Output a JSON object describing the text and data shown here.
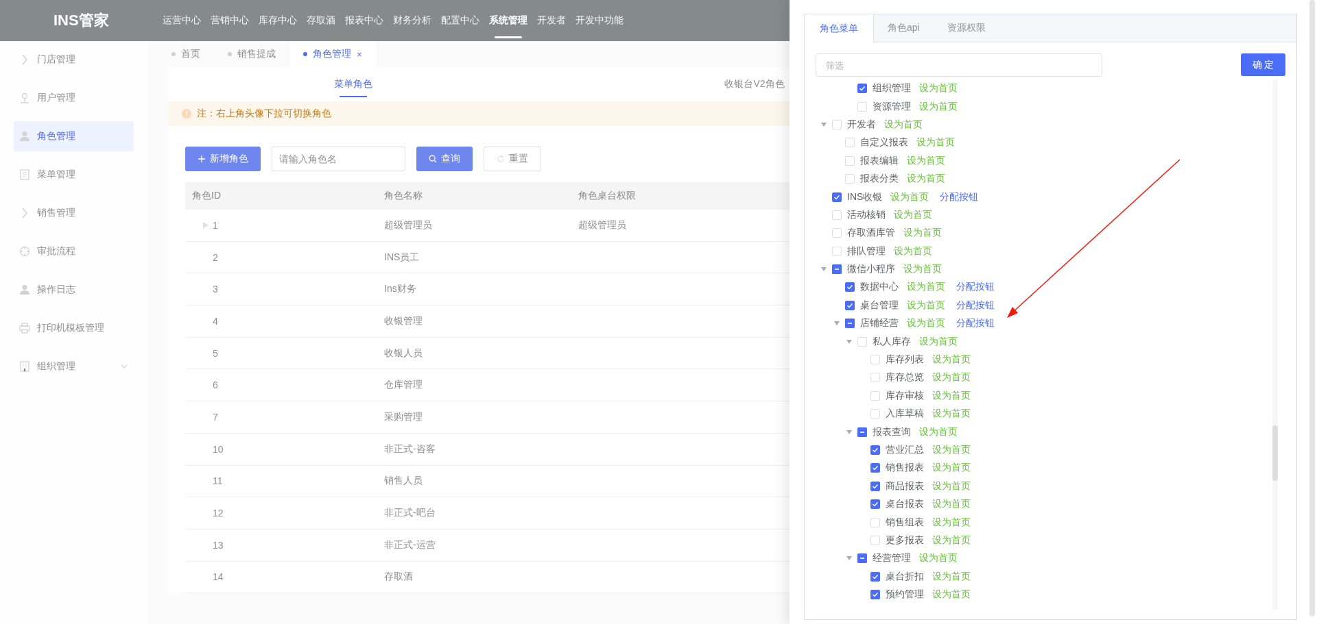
{
  "app": {
    "logo": "INS管家"
  },
  "top_nav": [
    {
      "label": "运营中心",
      "selected": false
    },
    {
      "label": "营销中心",
      "selected": false
    },
    {
      "label": "库存中心",
      "selected": false
    },
    {
      "label": "存取酒",
      "selected": false
    },
    {
      "label": "报表中心",
      "selected": false
    },
    {
      "label": "财务分析",
      "selected": false
    },
    {
      "label": "配置中心",
      "selected": false
    },
    {
      "label": "系统管理",
      "selected": true
    },
    {
      "label": "开发者",
      "selected": false
    },
    {
      "label": "开发中功能",
      "selected": false
    }
  ],
  "sidebar": {
    "items": [
      {
        "label": "门店管理",
        "selected": false
      },
      {
        "label": "用户管理",
        "selected": false
      },
      {
        "label": "角色管理",
        "selected": true
      },
      {
        "label": "菜单管理",
        "selected": false
      },
      {
        "label": "销售管理",
        "selected": false
      },
      {
        "label": "审批流程",
        "selected": false
      },
      {
        "label": "操作日志",
        "selected": false
      },
      {
        "label": "打印机模板管理",
        "selected": false
      },
      {
        "label": "组织管理",
        "selected": false,
        "expandable": true
      }
    ]
  },
  "page_tabs": [
    {
      "label": "首页",
      "selected": false,
      "closable": false
    },
    {
      "label": "销售提成",
      "selected": false,
      "closable": false
    },
    {
      "label": "角色管理",
      "selected": true,
      "closable": true,
      "close": "×"
    }
  ],
  "role_tabs": [
    {
      "label": "菜单角色",
      "selected": true
    },
    {
      "label": "收银台V2角色",
      "selected": false
    }
  ],
  "notice": "注：右上角头像下拉可切换角色",
  "toolbar": {
    "add_button": "新增角色",
    "search": {
      "placeholder": "请输入角色名"
    },
    "query_button": "查询",
    "reset_button": "重置"
  },
  "table": {
    "columns": [
      "角色ID",
      "角色名称",
      "角色桌台权限"
    ],
    "rows": [
      {
        "cells": [
          "1",
          "超级管理员",
          "超级管理员"
        ],
        "expandable": true
      },
      {
        "cells": [
          "2",
          "INS员工",
          ""
        ],
        "expandable": false
      },
      {
        "cells": [
          "3",
          "Ins财务",
          ""
        ],
        "expandable": false
      },
      {
        "cells": [
          "4",
          "收银管理",
          ""
        ],
        "expandable": false
      },
      {
        "cells": [
          "5",
          "收银人员",
          ""
        ],
        "expandable": false
      },
      {
        "cells": [
          "6",
          "仓库管理",
          ""
        ],
        "expandable": false
      },
      {
        "cells": [
          "7",
          "采购管理",
          ""
        ],
        "expandable": false
      },
      {
        "cells": [
          "10",
          "非正式-咨客",
          ""
        ],
        "expandable": false
      },
      {
        "cells": [
          "11",
          "销售人员",
          ""
        ],
        "expandable": false
      },
      {
        "cells": [
          "12",
          "非正式-吧台",
          ""
        ],
        "expandable": false
      },
      {
        "cells": [
          "13",
          "非正式-运营",
          ""
        ],
        "expandable": false
      },
      {
        "cells": [
          "14",
          "存取酒",
          ""
        ],
        "expandable": false
      }
    ]
  },
  "drawer": {
    "tabs": [
      {
        "label": "角色菜单",
        "selected": true
      },
      {
        "label": "角色api",
        "selected": false
      },
      {
        "label": "资源权限",
        "selected": false
      }
    ],
    "filter": {
      "placeholder": "筛选"
    },
    "confirm_button": "确 定",
    "tree": [
      {
        "children": [
          {
            "children": [
              {
                "label": "组织管理",
                "checked": true,
                "indeterminate": false,
                "actions": [
                  {
                    "kind": "home",
                    "label": "设为首页"
                  }
                ]
              },
              {
                "label": "资源管理",
                "checked": false,
                "indeterminate": false,
                "actions": [
                  {
                    "kind": "home",
                    "label": "设为首页"
                  }
                ]
              }
            ]
          }
        ]
      },
      {
        "label": "开发者",
        "checked": false,
        "indeterminate": false,
        "expanded": true,
        "actions": [
          {
            "kind": "home",
            "label": "设为首页"
          }
        ],
        "children": [
          {
            "label": "自定义报表",
            "checked": false,
            "indeterminate": false,
            "actions": [
              {
                "kind": "home",
                "label": "设为首页"
              }
            ]
          },
          {
            "label": "报表编辑",
            "checked": false,
            "indeterminate": false,
            "actions": [
              {
                "kind": "home",
                "label": "设为首页"
              }
            ]
          },
          {
            "label": "报表分类",
            "checked": false,
            "indeterminate": false,
            "actions": [
              {
                "kind": "home",
                "label": "设为首页"
              }
            ]
          }
        ]
      },
      {
        "label": "INS收银",
        "checked": true,
        "indeterminate": false,
        "actions": [
          {
            "kind": "home",
            "label": "设为首页"
          },
          {
            "kind": "assign",
            "label": "分配按钮"
          }
        ]
      },
      {
        "label": "活动核销",
        "checked": false,
        "indeterminate": false,
        "actions": [
          {
            "kind": "home",
            "label": "设为首页"
          }
        ]
      },
      {
        "label": "存取酒库管",
        "checked": false,
        "indeterminate": false,
        "actions": [
          {
            "kind": "home",
            "label": "设为首页"
          }
        ]
      },
      {
        "label": "排队管理",
        "checked": false,
        "indeterminate": false,
        "actions": [
          {
            "kind": "home",
            "label": "设为首页"
          }
        ]
      },
      {
        "label": "微信小程序",
        "checked": false,
        "indeterminate": true,
        "expanded": true,
        "actions": [
          {
            "kind": "home",
            "label": "设为首页"
          }
        ],
        "children": [
          {
            "label": "数据中心",
            "checked": true,
            "indeterminate": false,
            "actions": [
              {
                "kind": "home",
                "label": "设为首页"
              },
              {
                "kind": "assign",
                "label": "分配按钮"
              }
            ]
          },
          {
            "label": "桌台管理",
            "checked": true,
            "indeterminate": false,
            "actions": [
              {
                "kind": "home",
                "label": "设为首页"
              },
              {
                "kind": "assign",
                "label": "分配按钮"
              }
            ]
          },
          {
            "label": "店铺经营",
            "checked": false,
            "indeterminate": true,
            "expanded": true,
            "actions": [
              {
                "kind": "home",
                "label": "设为首页"
              },
              {
                "kind": "assign",
                "label": "分配按钮"
              }
            ],
            "children": [
              {
                "label": "私人库存",
                "checked": false,
                "indeterminate": false,
                "expanded": true,
                "actions": [
                  {
                    "kind": "home",
                    "label": "设为首页"
                  }
                ],
                "children": [
                  {
                    "label": "库存列表",
                    "checked": false,
                    "indeterminate": false,
                    "actions": [
                      {
                        "kind": "home",
                        "label": "设为首页"
                      }
                    ]
                  },
                  {
                    "label": "库存总览",
                    "checked": false,
                    "indeterminate": false,
                    "actions": [
                      {
                        "kind": "home",
                        "label": "设为首页"
                      }
                    ]
                  },
                  {
                    "label": "库存审核",
                    "checked": false,
                    "indeterminate": false,
                    "actions": [
                      {
                        "kind": "home",
                        "label": "设为首页"
                      }
                    ]
                  },
                  {
                    "label": "入库草稿",
                    "checked": false,
                    "indeterminate": false,
                    "actions": [
                      {
                        "kind": "home",
                        "label": "设为首页"
                      }
                    ]
                  }
                ]
              },
              {
                "label": "报表查询",
                "checked": false,
                "indeterminate": true,
                "expanded": true,
                "actions": [
                  {
                    "kind": "home",
                    "label": "设为首页"
                  }
                ],
                "children": [
                  {
                    "label": "营业汇总",
                    "checked": true,
                    "indeterminate": false,
                    "actions": [
                      {
                        "kind": "home",
                        "label": "设为首页"
                      }
                    ]
                  },
                  {
                    "label": "销售报表",
                    "checked": true,
                    "indeterminate": false,
                    "actions": [
                      {
                        "kind": "home",
                        "label": "设为首页"
                      }
                    ]
                  },
                  {
                    "label": "商品报表",
                    "checked": true,
                    "indeterminate": false,
                    "actions": [
                      {
                        "kind": "home",
                        "label": "设为首页"
                      }
                    ]
                  },
                  {
                    "label": "桌台报表",
                    "checked": true,
                    "indeterminate": false,
                    "actions": [
                      {
                        "kind": "home",
                        "label": "设为首页"
                      }
                    ]
                  },
                  {
                    "label": "销售组表",
                    "checked": false,
                    "indeterminate": false,
                    "actions": [
                      {
                        "kind": "home",
                        "label": "设为首页"
                      }
                    ]
                  },
                  {
                    "label": "更多报表",
                    "checked": false,
                    "indeterminate": false,
                    "actions": [
                      {
                        "kind": "home",
                        "label": "设为首页"
                      }
                    ]
                  }
                ]
              },
              {
                "label": "经营管理",
                "checked": false,
                "indeterminate": true,
                "expanded": true,
                "actions": [
                  {
                    "kind": "home",
                    "label": "设为首页"
                  }
                ],
                "children": [
                  {
                    "label": "桌台折扣",
                    "checked": true,
                    "indeterminate": false,
                    "actions": [
                      {
                        "kind": "home",
                        "label": "设为首页"
                      }
                    ]
                  },
                  {
                    "label": "预约管理",
                    "checked": true,
                    "indeterminate": false,
                    "actions": [
                      {
                        "kind": "home",
                        "label": "设为首页"
                      }
                    ]
                  }
                ]
              }
            ]
          }
        ]
      }
    ]
  }
}
